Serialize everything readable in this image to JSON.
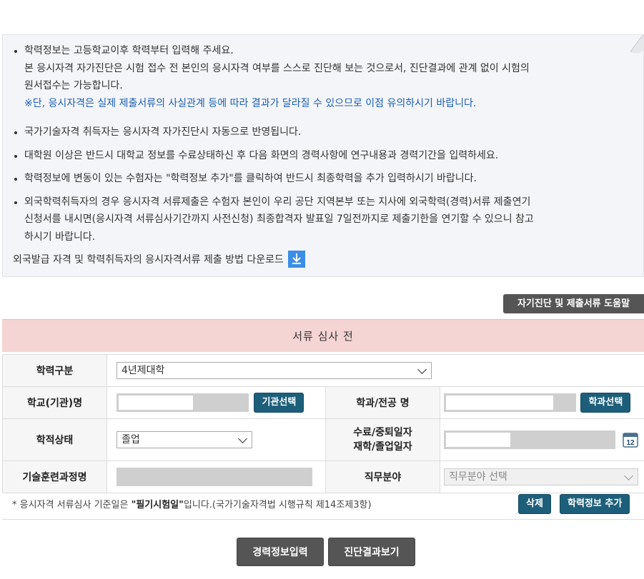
{
  "notice": {
    "items": [
      {
        "lines": [
          "학력정보는 고등학교이후 학력부터 입력해 주세요.",
          "본 응시자격 자가진단은 시험 접수 전 본인의 응시자격 여부를 스스로 진단해 보는 것으로서, 진단결과에 관계 없이 시험의",
          "원서접수는 가능합니다."
        ],
        "warning": "※단, 응시자격은 실제 제출서류의 사실관계 등에 따라 결과가 달라질 수 있으므로 이점 유의하시기 바랍니다."
      },
      {
        "text": "국가기술자격 취득자는 응시자격 자가진단시 자동으로 반영됩니다."
      },
      {
        "text": "대학원 이상은 반드시 대학교 정보를 수료상태하신 후 다음 화면의 경력사항에 연구내용과 경력기간을 입력하세요."
      },
      {
        "text": "학력정보에 변동이 있는 수험자는 \"학력정보 추가\"를 클릭하여 반드시 최종학력을 추가 입력하시기 바랍니다."
      },
      {
        "lines": [
          "외국학력취득자의 경우 응시자격 서류제출은 수험자 본인이 우리 공단 지역본부 또는 지사에 외국학력(경력)서류 제출연기",
          "신청서를 내시면(응시자격 서류심사기간까지 사전신청) 최종합격자 발표일 7일전까지로 제출기한을 연기할 수 있으니 참고",
          "하시기 바랍니다."
        ]
      }
    ],
    "download_label": "외국발급 자격 및 학력취득자의 응시자격서류 제출 방법 다운로드"
  },
  "help_button": "자기진단 및 제출서류 도움말",
  "section_title": "서류 심사 전",
  "form": {
    "education_type_label": "학력구분",
    "education_type_value": "4년제대학",
    "school_label": "학교(기관)명",
    "school_select_button": "기관선택",
    "major_label": "학과/전공 명",
    "major_select_button": "학과선택",
    "status_label": "학적상태",
    "status_value": "졸업",
    "date_label_1": "수료/중퇴일자",
    "date_label_2": "재학/졸업일자",
    "calendar_day": "12",
    "training_label": "기술훈련과정명",
    "job_field_label": "직무분야",
    "job_field_placeholder": "직무분야 선택"
  },
  "note": {
    "prefix": "* 응시자격 서류심사 기준일은 ",
    "bold": "\"필기시험일\"",
    "suffix": "입니다.(국가기술자격법 시행규칙 제14조제3항)"
  },
  "delete_button": "삭제",
  "add_button": "학력정보 추가",
  "career_button": "경력정보입력",
  "result_button": "진단결과보기",
  "colors": {
    "teal": "#1d5f7a",
    "section_bg": "#f5d4d4",
    "dark_button": "#555555",
    "notice_blue": "#1a5fb4"
  }
}
